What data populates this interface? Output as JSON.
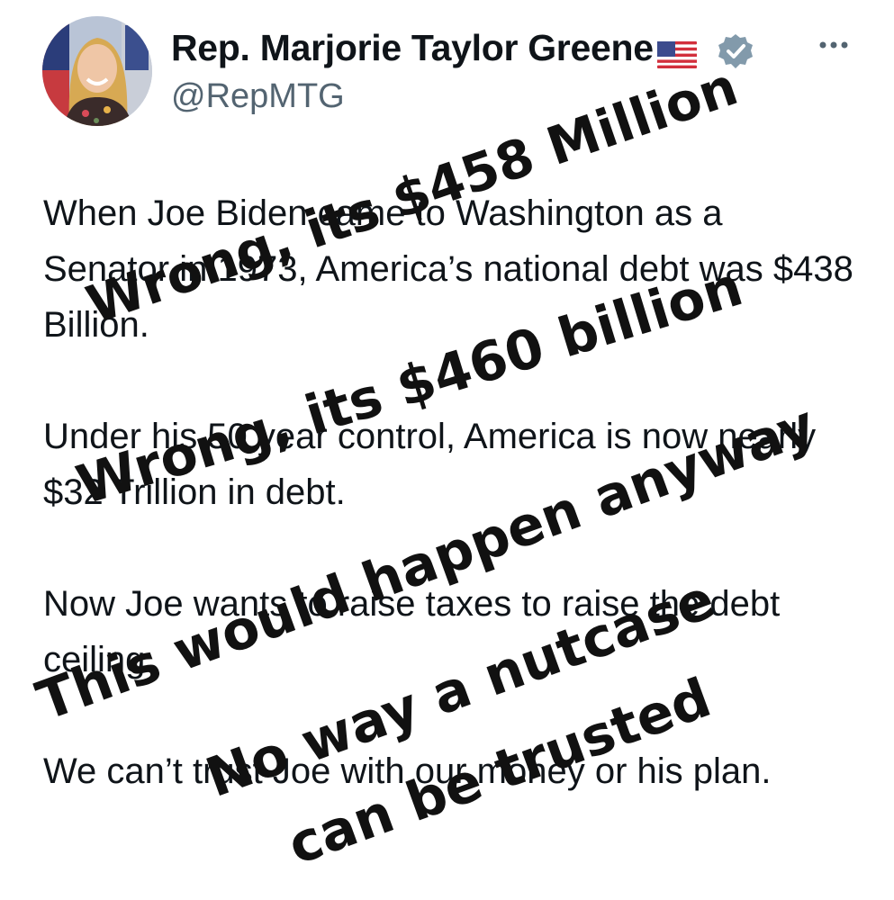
{
  "tweet": {
    "author": {
      "display_name": "Rep. Marjorie Taylor Greene",
      "flag_emoji": "🇺🇸",
      "verified": true,
      "handle": "@RepMTG",
      "avatar_icon": "profile-photo"
    },
    "more_menu_icon": "ellipsis-icon",
    "body": [
      "When Joe Biden came to Washington as a Senator in 1973, America’s national debt was $438 Billion.",
      "Under his 50 year control, America is now nearly $32 Trillion in debt.",
      "Now Joe wants to raise taxes to raise the debt ceiling.",
      "We can’t trust Joe with our money or his plan."
    ]
  },
  "annotations": [
    "Wrong, its $458 Million",
    "Wrong, its $460 billion",
    "This would happen anyway",
    "No way a nutcase",
    "can be trusted"
  ],
  "colors": {
    "text": "#0f1419",
    "secondary": "#536471",
    "verified_badge": "#829aab",
    "annotation_ink": "#111111"
  }
}
